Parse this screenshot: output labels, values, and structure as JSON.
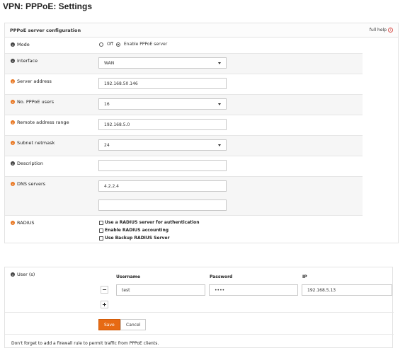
{
  "page": {
    "title": "VPN: PPPoE: Settings"
  },
  "panel": {
    "header": "PPPoE server configuration",
    "full_help": "full help",
    "mode": {
      "label": "Mode",
      "options": [
        "Off",
        "Enable PPPoE server"
      ],
      "selected": "Enable PPPoE server"
    },
    "interface": {
      "label": "Interface",
      "value": "WAN"
    },
    "server_address": {
      "label": "Server address",
      "value": "192.168.50.146"
    },
    "num_users": {
      "label": "No. PPPoE users",
      "value": "16"
    },
    "remote_range": {
      "label": "Remote address range",
      "value": "192.168.5.0"
    },
    "subnet": {
      "label": "Subnet netmask",
      "value": "24"
    },
    "description": {
      "label": "Description",
      "value": ""
    },
    "dns": {
      "label": "DNS servers",
      "primary": "4.2.2.4",
      "secondary": ""
    },
    "radius": {
      "label": "RADIUS",
      "options": [
        "Use a RADIUS server for authentication",
        "Enable RADIUS accounting",
        "Use Backup RADIUS Server"
      ]
    }
  },
  "users": {
    "label": "User (s)",
    "columns": {
      "username": "Username",
      "password": "Password",
      "ip": "IP"
    },
    "rows": [
      {
        "username": "test",
        "password": "••••",
        "ip": "192.168.5.13"
      }
    ],
    "remove_glyph": "−",
    "add_glyph": "+"
  },
  "actions": {
    "save": "Save",
    "cancel": "Cancel"
  },
  "footer_note": "Don't forget to add a firewall rule to permit traffic from PPPoE clients.",
  "colors": {
    "accent": "#e76a13",
    "info_orange": "#e87722",
    "help_red": "#d9534f"
  }
}
